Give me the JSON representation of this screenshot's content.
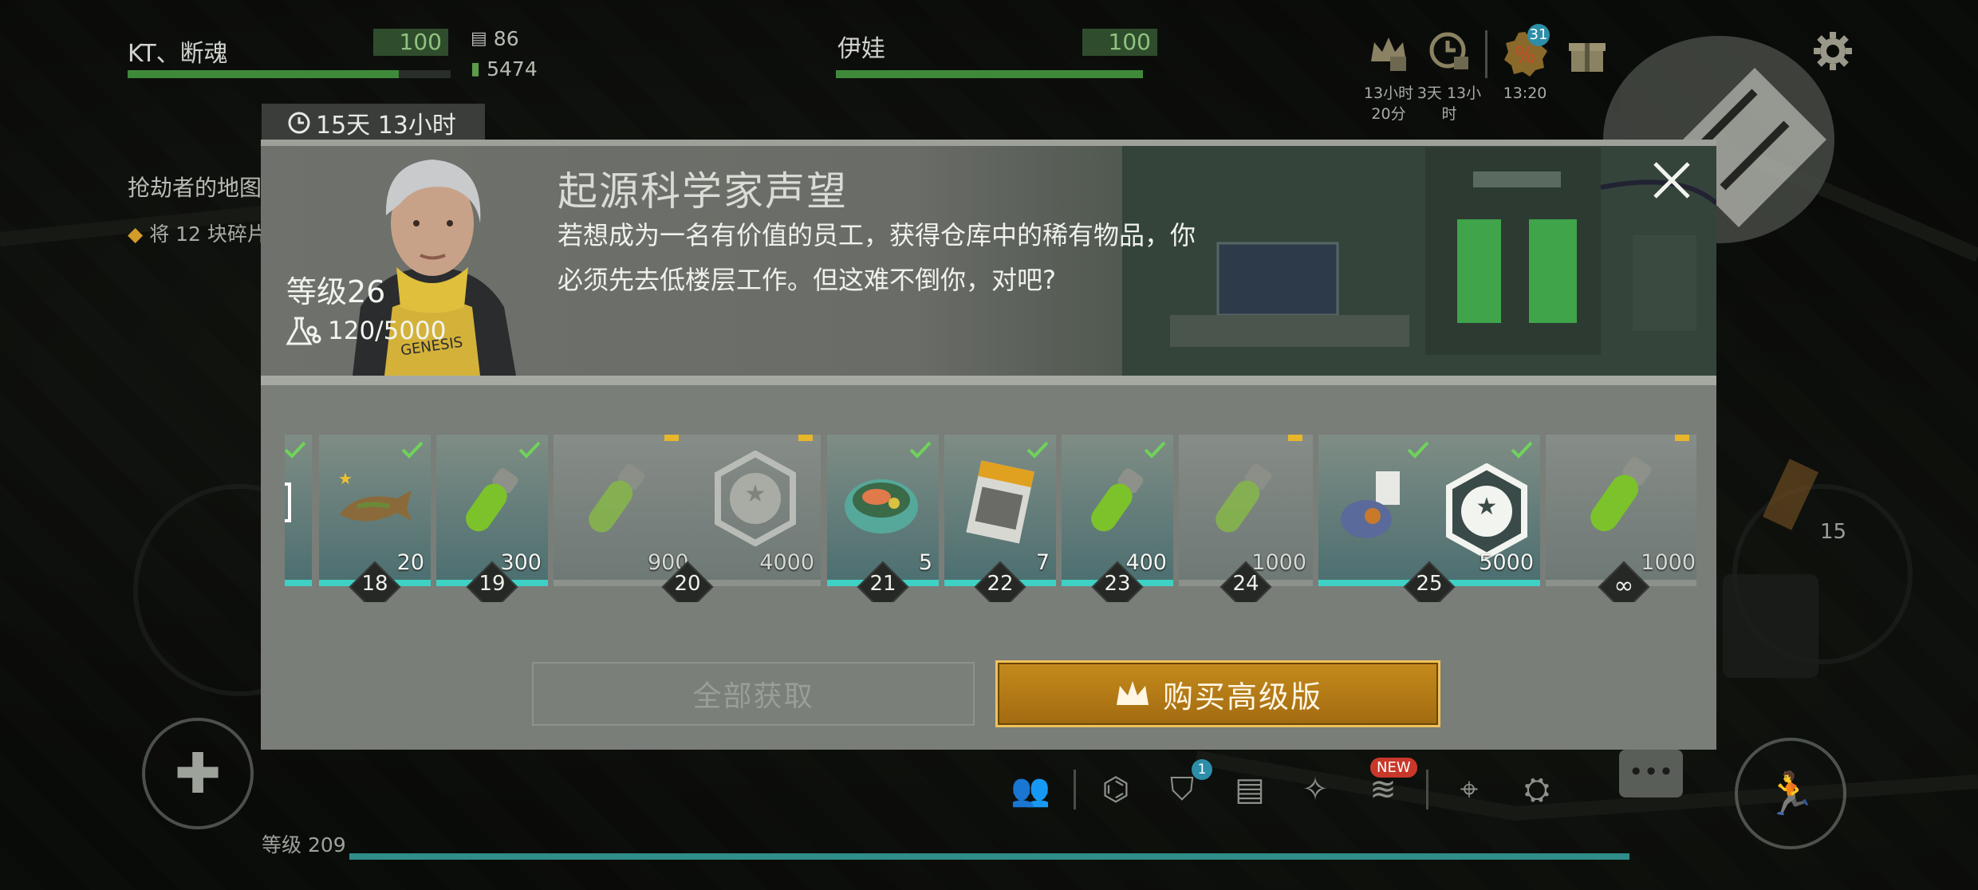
{
  "hud": {
    "player1": {
      "name": "KT、断魂",
      "hp": "100",
      "hp_fill": 0.84
    },
    "player2": {
      "name": "伊娃",
      "hp": "100",
      "hp_fill": 1.0
    },
    "resource1": "86",
    "resource2": "5474",
    "timers": [
      {
        "label": "13小时\n20分",
        "icon": "crown-gift-icon"
      },
      {
        "label": "3天 13小\n时",
        "icon": "clock-gift-icon"
      },
      {
        "label": "13:20",
        "icon": "discount-icon",
        "badge": "31"
      }
    ],
    "side_title": "抢劫者的地图",
    "side_sub": "将 12 块碎片",
    "ammo_count": "15",
    "level_label": "等级 209",
    "badges": {
      "new": "NEW",
      "shield": "1"
    }
  },
  "dialog": {
    "timer": "15天 13小时",
    "level": "等级26",
    "xp": "120/5000",
    "title": "起源科学家声望",
    "description": "若想成为一名有价值的员工，获得仓库中的稀有物品，你必须先去低楼层工作。但这难不倒你，对吧?",
    "buttons": {
      "claim_all": "全部获取",
      "buy_premium": "购买高级版"
    }
  },
  "track": [
    {
      "level": "18",
      "reward": "pike-fish",
      "qty": "20",
      "claimed": true
    },
    {
      "level": "19",
      "reward": "green-vial",
      "qty": "300",
      "claimed": true
    },
    {
      "level": "20",
      "rewards": [
        {
          "reward": "green-vial",
          "qty": "900",
          "locked": true
        },
        {
          "reward": "scientist-emblem",
          "qty": "4000",
          "locked": true
        }
      ]
    },
    {
      "level": "21",
      "reward": "fish-bowl",
      "qty": "5",
      "claimed": true
    },
    {
      "level": "22",
      "reward": "offroad-magazine",
      "qty": "7",
      "claimed": true
    },
    {
      "level": "23",
      "reward": "green-vial",
      "qty": "400",
      "claimed": true
    },
    {
      "level": "24",
      "reward": "green-vial",
      "qty": "1000",
      "locked": true
    },
    {
      "level": "25",
      "rewards": [
        {
          "reward": "outfit-set",
          "claimed": true
        },
        {
          "reward": "scientist-emblem",
          "qty": "5000",
          "claimed": true
        }
      ]
    },
    {
      "level": "∞",
      "reward": "green-vial",
      "qty": "1000",
      "locked": true
    }
  ],
  "colors": {
    "progress": "#3fd1c4",
    "premium": "#c58b1d",
    "check": "#6fd35a",
    "lock": "#e8b62a"
  }
}
